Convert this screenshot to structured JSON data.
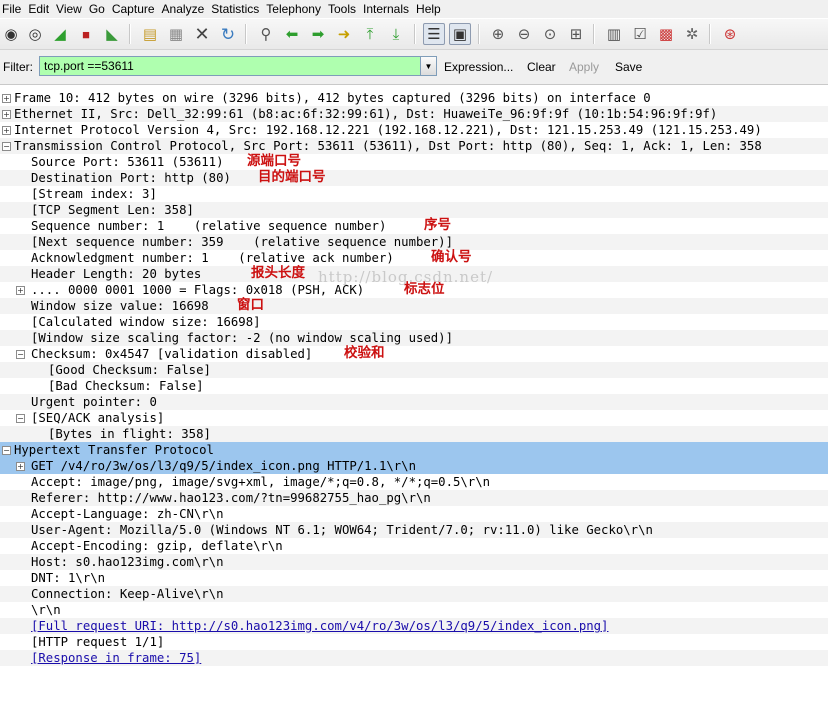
{
  "menu": [
    "File",
    "Edit",
    "View",
    "Go",
    "Capture",
    "Analyze",
    "Statistics",
    "Telephony",
    "Tools",
    "Internals",
    "Help"
  ],
  "filter": {
    "label": "Filter:",
    "value": "tcp.port ==53611",
    "buttons": [
      "Expression...",
      "Clear",
      "Apply",
      "Save"
    ]
  },
  "toolbar_icons": [
    "interface-list",
    "capture-options",
    "start-capture",
    "stop-capture",
    "restart-capture",
    "open-file",
    "save-file",
    "close-file",
    "reload",
    "find",
    "go-back",
    "go-forward",
    "go-to-packet",
    "go-first",
    "go-last",
    "colorize",
    "autoscroll",
    "zoom-in",
    "zoom-out",
    "zoom-normal",
    "resize-columns",
    "capture-filters",
    "display-filters",
    "coloring-rules",
    "preferences",
    "help"
  ],
  "tree": [
    {
      "text": "Frame 10: 412 bytes on wire (3296 bits), 412 bytes captured (3296 bits) on interface 0",
      "level": 0,
      "expander": "+"
    },
    {
      "text": "Ethernet II, Src: Dell_32:99:61 (b8:ac:6f:32:99:61), Dst: HuaweiTe_96:9f:9f (10:1b:54:96:9f:9f)",
      "level": 0,
      "expander": "+"
    },
    {
      "text": "Internet Protocol Version 4, Src: 192.168.12.221 (192.168.12.221), Dst: 121.15.253.49 (121.15.253.49)",
      "level": 0,
      "expander": "+"
    },
    {
      "text": "Transmission Control Protocol, Src Port: 53611 (53611), Dst Port: http (80), Seq: 1, Ack: 1, Len: 358",
      "level": 0,
      "expander": "-"
    },
    {
      "text": "Source Port: 53611 (53611)",
      "level": 1,
      "note": "源端口号"
    },
    {
      "text": "Destination Port: http (80)",
      "level": 1,
      "note": "目的端口号"
    },
    {
      "text": "[Stream index: 3]",
      "level": 1
    },
    {
      "text": "[TCP Segment Len: 358]",
      "level": 1
    },
    {
      "text": "Sequence number: 1    (relative sequence number)",
      "level": 1,
      "note": "序号"
    },
    {
      "text": "[Next sequence number: 359    (relative sequence number)]",
      "level": 1
    },
    {
      "text": "Acknowledgment number: 1    (relative ack number)",
      "level": 1,
      "note": "确认号"
    },
    {
      "text": "Header Length: 20 bytes",
      "level": 1,
      "note": "报头长度"
    },
    {
      "text": ".... 0000 0001 1000 = Flags: 0x018 (PSH, ACK)",
      "level": 1,
      "expander": "+",
      "note": "标志位"
    },
    {
      "text": "Window size value: 16698",
      "level": 1,
      "note": "窗口"
    },
    {
      "text": "[Calculated window size: 16698]",
      "level": 1
    },
    {
      "text": "[Window size scaling factor: -2 (no window scaling used)]",
      "level": 1
    },
    {
      "text": "Checksum: 0x4547 [validation disabled]",
      "level": 1,
      "expander": "-",
      "note": "校验和"
    },
    {
      "text": "[Good Checksum: False]",
      "level": 2
    },
    {
      "text": "[Bad Checksum: False]",
      "level": 2
    },
    {
      "text": "Urgent pointer: 0",
      "level": 1
    },
    {
      "text": "[SEQ/ACK analysis]",
      "level": 1,
      "expander": "-"
    },
    {
      "text": "[Bytes in flight: 358]",
      "level": 2
    },
    {
      "text": "Hypertext Transfer Protocol",
      "level": 0,
      "expander": "-",
      "selected": true
    },
    {
      "text": "GET /v4/ro/3w/os/l3/q9/5/index_icon.png HTTP/1.1\\r\\n",
      "level": 1,
      "expander": "+",
      "selected": true
    },
    {
      "text": "Accept: image/png, image/svg+xml, image/*;q=0.8, */*;q=0.5\\r\\n",
      "level": 1
    },
    {
      "text": "Referer: http://www.hao123.com/?tn=99682755_hao_pg\\r\\n",
      "level": 1
    },
    {
      "text": "Accept-Language: zh-CN\\r\\n",
      "level": 1
    },
    {
      "text": "User-Agent: Mozilla/5.0 (Windows NT 6.1; WOW64; Trident/7.0; rv:11.0) like Gecko\\r\\n",
      "level": 1
    },
    {
      "text": "Accept-Encoding: gzip, deflate\\r\\n",
      "level": 1
    },
    {
      "text": "Host: s0.hao123img.com\\r\\n",
      "level": 1
    },
    {
      "text": "DNT: 1\\r\\n",
      "level": 1
    },
    {
      "text": "Connection: Keep-Alive\\r\\n",
      "level": 1
    },
    {
      "text": "\\r\\n",
      "level": 1
    },
    {
      "text": "[Full request URI: http://s0.hao123img.com/v4/ro/3w/os/l3/q9/5/index_icon.png]",
      "level": 1,
      "link": true
    },
    {
      "text": "[HTTP request 1/1]",
      "level": 1
    },
    {
      "text": "[Response in frame: 75]",
      "level": 1,
      "link": true
    }
  ],
  "watermark": "http://blog.csdn.net/"
}
